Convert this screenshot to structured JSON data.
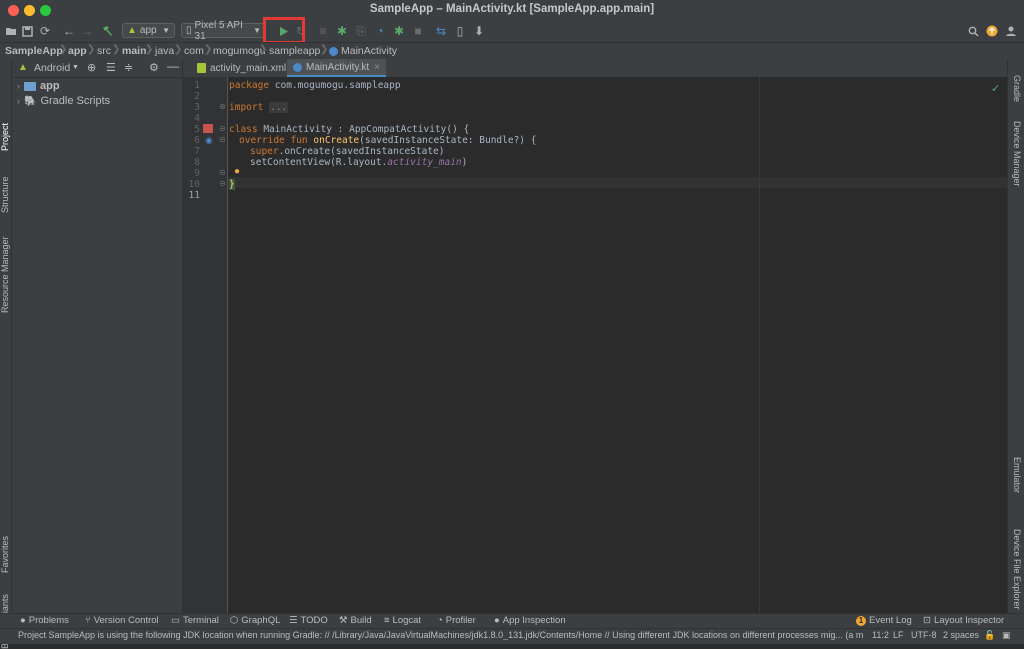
{
  "window": {
    "title": "SampleApp – MainActivity.kt [SampleApp.app.main]"
  },
  "toolbar": {
    "run_config": "app",
    "device": "Pixel 5 API 31",
    "icons": [
      "folder-icon",
      "save-icon",
      "sync-icon",
      "back-icon",
      "forward-icon",
      "hammer-icon",
      "android-icon",
      "device-icon",
      "run-icon",
      "apply-changes-icon",
      "debug-icon",
      "profile-icon",
      "coverage-icon",
      "attach-icon",
      "stop-icon",
      "avd-manager-icon",
      "sdk-manager-icon",
      "search-icon",
      "update-icon",
      "avatar-icon"
    ]
  },
  "breadcrumb": {
    "items": [
      "SampleApp",
      "app",
      "src",
      "main",
      "java",
      "com",
      "mogumogu",
      "sampleapp",
      "MainActivity"
    ]
  },
  "left_strip": {
    "project": "Project",
    "structure": "Structure",
    "resource_manager": "Resource Manager",
    "favorites": "Favorites",
    "build_variants": "Build Variants"
  },
  "project_panel": {
    "view_mode": "Android",
    "tree": [
      {
        "label": "app"
      },
      {
        "label": "Gradle Scripts"
      }
    ]
  },
  "tabs": [
    {
      "label": "activity_main.xml"
    },
    {
      "label": "MainActivity.kt"
    }
  ],
  "editor": {
    "line_numbers": [
      "1",
      "2",
      "3",
      "4",
      "5",
      "6",
      "7",
      "8",
      "9",
      "10",
      "11"
    ],
    "code": {
      "l1_kw": "package",
      "l1_rest": " com.mogumogu.sampleapp",
      "l3_kw": "import",
      "l3_fold": "...",
      "l6_kw": "class",
      "l6_rest": " MainActivity : AppCompatActivity() {",
      "l7_kw": "override fun",
      "l7_fn": "onCreate",
      "l7_rest": "(savedInstanceState: Bundle?) {",
      "l8_kw": "super",
      "l8_rest": ".onCreate(savedInstanceState)",
      "l9_rest": "setContentView(R.layout.",
      "l9_it": "activity_main",
      "l9_end": ")",
      "l11": "}"
    }
  },
  "right_strip": {
    "gradle": "Gradle",
    "device_manager": "Device Manager",
    "emulator": "Emulator",
    "device_file_explorer": "Device File Explorer"
  },
  "bottom_tools": [
    "Problems",
    "Version Control",
    "Terminal",
    "GraphQL",
    "TODO",
    "Build",
    "Logcat",
    "Profiler",
    "App Inspection"
  ],
  "bottom_tools_right": [
    "Event Log",
    "Layout Inspector"
  ],
  "event_log_badge": "1",
  "status": {
    "message": "Project SampleApp is using the following JDK location when running Gradle: // /Library/Java/JavaVirtualMachines/jdk1.8.0_131.jdk/Contents/Home // Using different JDK locations on different processes mig... (a minute ago)",
    "position": "11:2",
    "line_sep": "LF",
    "encoding": "UTF-8",
    "indent": "2 spaces"
  },
  "colors": {
    "accent": "#4a88c7",
    "run_green": "#59a869",
    "highlight_red": "#e53935"
  }
}
